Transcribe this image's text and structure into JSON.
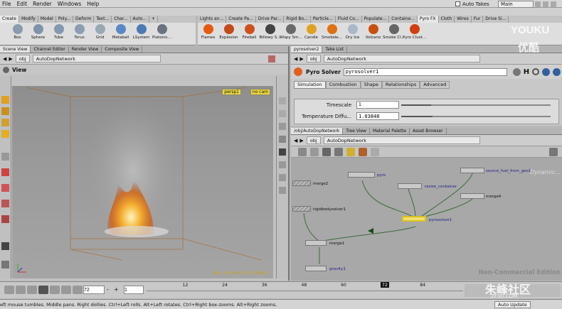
{
  "menu": [
    "File",
    "Edit",
    "Render",
    "Windows",
    "Help"
  ],
  "top_right": {
    "auto_takes": "Auto Takes",
    "desktop": "Main"
  },
  "shelf_tabs_left": [
    "Create",
    "Modify",
    "Model",
    "Poly...",
    "Deform",
    "Text...",
    "Char...",
    "Auto...",
    "+"
  ],
  "shelf_tabs_right": [
    "Lights an...",
    "Create Pa...",
    "Drive Par...",
    "Rigid Bo...",
    "Particle...",
    "Fluid Co...",
    "Populate...",
    "Containe...",
    "Pyro FX",
    "Cloth",
    "Wires",
    "Fur",
    "Drive Si..."
  ],
  "shelf_tools_left": [
    {
      "label": "Box",
      "color": "#8a9bb0"
    },
    {
      "label": "Sphere",
      "color": "#7f93aa"
    },
    {
      "label": "Tube",
      "color": "#8598ae"
    },
    {
      "label": "Torus",
      "color": "#8b9db2"
    },
    {
      "label": "Grid",
      "color": "#9aa7b6"
    },
    {
      "label": "Metaball",
      "color": "#5a87c8"
    },
    {
      "label": "LSystem",
      "color": "#4d79b5"
    },
    {
      "label": "Platonic...",
      "color": "#6a7380"
    }
  ],
  "shelf_tools_right": [
    {
      "label": "Flames",
      "color": "#e65a10"
    },
    {
      "label": "Explosion",
      "color": "#c44a1a"
    },
    {
      "label": "Fireball",
      "color": "#d0501a"
    },
    {
      "label": "Billowy S...",
      "color": "#444444"
    },
    {
      "label": "Wispy Sm...",
      "color": "#6a6a6a"
    },
    {
      "label": "Candle",
      "color": "#e0a020"
    },
    {
      "label": "Smokele...",
      "color": "#e07010"
    },
    {
      "label": "Dry Ice",
      "color": "#a8b8c8"
    },
    {
      "label": "Volcano",
      "color": "#c85010"
    },
    {
      "label": "Smoke Cl...",
      "color": "#666666"
    },
    {
      "label": "Pyro Clust...",
      "color": "#d04010"
    }
  ],
  "left_pane": {
    "tabs": [
      "Scene View",
      "Channel Editor",
      "Render View",
      "Composite View"
    ],
    "path_obj": "obj",
    "path_net": "AutoDopNetwork",
    "view_title": "View",
    "camera_persp": "persp1",
    "camera_nocam": "no cam",
    "watermark": "Non-Commercial Edition"
  },
  "param_pane": {
    "tabs": [
      "pyrosolver2",
      "Take List"
    ],
    "path_obj": "obj",
    "path_net": "AutoDopNetwork",
    "node_type": "Pyro Solver",
    "node_name": "pyrosolver1",
    "sub_tabs": [
      "Simulation",
      "Combustion",
      "Shape",
      "Relationships",
      "Advanced"
    ],
    "timescale_label": "Timescale",
    "timescale_value": "1",
    "timescale_fraction": 0.2,
    "tempdiff_label": "Temperature Diffu...",
    "tempdiff_value": "1.03848",
    "tempdiff_fraction": 0.21
  },
  "network_pane": {
    "tabs": [
      "/obj/AutoDopNetwork",
      "Tree View",
      "Material Palette",
      "Asset Browser"
    ],
    "path_obj": "obj",
    "path_net": "AutoDopNetwork",
    "context_label": "Dynamic...",
    "watermark": "Non-Commercial Edition",
    "nodes": {
      "pyro": "pyro",
      "merge2": "merge2",
      "resize": "resize_container",
      "source": "source_fuel_from_geo1",
      "merge4": "merge4",
      "rigid": "rigidbodysolver1",
      "solver": "pyrosolver1",
      "merge1": "merge1",
      "gravity": "gravity1"
    }
  },
  "timeline": {
    "frame": "72",
    "start": "1",
    "ticks": [
      "12",
      "24",
      "36",
      "48",
      "60",
      "72",
      "84"
    ],
    "current_label": "72"
  },
  "status": {
    "text": "eft mouse tumbles. Middle pans. Right dollies. Ctrl+Left rolls. Alt+Left rotates. Ctrl+Right box-zooms. Alt+Right zooms.",
    "auto_update": "Auto Update"
  },
  "overlay": {
    "brand_top": "YOUKU",
    "brand_sub": "优酷",
    "site": "朱峰社区",
    "site_url": "ZF3D.COM"
  }
}
